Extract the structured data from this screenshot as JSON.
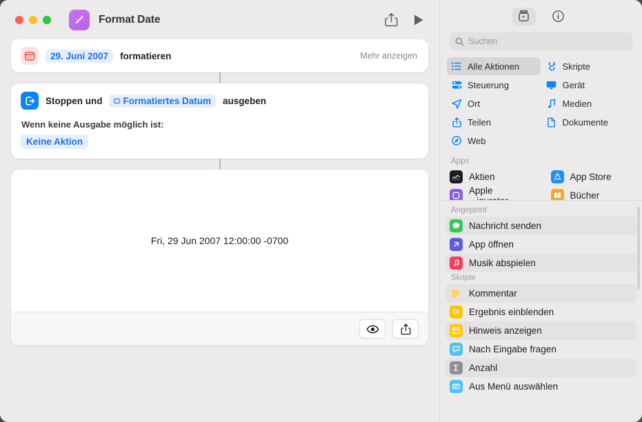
{
  "window": {
    "title": "Format Date",
    "app_icon": "magic-wand-icon",
    "traffic_lights": [
      "close",
      "minimize",
      "zoom"
    ],
    "toolbar": {
      "share_label": "share-icon",
      "run_label": "play-icon"
    }
  },
  "editor": {
    "actions": [
      {
        "id": "format-date",
        "icon": "calendar-icon",
        "token": "29. Juni 2007",
        "suffix": "formatieren",
        "more_label": "Mehr anzeigen"
      },
      {
        "id": "stop-and-output",
        "icon": "stop-output-icon",
        "prefix": "Stoppen und",
        "token": "Formatiertes Datum",
        "suffix": "ausgeben",
        "sub_label": "Wenn keine Ausgabe möglich ist:",
        "sub_token": "Keine Aktion"
      }
    ],
    "result": {
      "text": "Fri, 29 Jun 2007 12:00:00 -0700",
      "quicklook_label": "eye-icon",
      "share_label": "share-icon"
    }
  },
  "sidebar": {
    "segments": [
      {
        "name": "action-library",
        "icon": "library-icon",
        "selected": true
      },
      {
        "name": "info",
        "icon": "info-circle-icon",
        "selected": false
      }
    ],
    "search": {
      "placeholder": "Suchen",
      "value": "",
      "icon": "search-icon"
    },
    "categories": [
      {
        "label": "Alle Aktionen",
        "icon": "list-icon",
        "color": "#0A84FF",
        "selected": true
      },
      {
        "label": "Skripte",
        "icon": "script-icon",
        "color": "#0A84FF",
        "selected": false
      },
      {
        "label": "Steuerung",
        "icon": "controls-icon",
        "color": "#0A84FF",
        "selected": false
      },
      {
        "label": "Gerät",
        "icon": "display-icon",
        "color": "#0A84FF",
        "selected": false
      },
      {
        "label": "Ort",
        "icon": "location-icon",
        "color": "#0A84FF",
        "selected": false
      },
      {
        "label": "Medien",
        "icon": "music-note-icon",
        "color": "#0A84FF",
        "selected": false
      },
      {
        "label": "Teilen",
        "icon": "share-icon",
        "color": "#0A84FF",
        "selected": false
      },
      {
        "label": "Dokumente",
        "icon": "document-icon",
        "color": "#0A84FF",
        "selected": false
      },
      {
        "label": "Web",
        "icon": "safari-icon",
        "color": "#0A84FF",
        "selected": false
      }
    ],
    "sections": [
      {
        "title": "Apps",
        "layout": "grid",
        "items": [
          {
            "label": "Aktien",
            "icon": "stocks-app-icon",
            "color": "#1C1C1E"
          },
          {
            "label": "App Store",
            "icon": "app-store-icon",
            "color": "#1D8FF8"
          },
          {
            "label": "Apple ...igurator",
            "icon": "apple-configurator-icon",
            "color": "#8E5CE0"
          },
          {
            "label": "Bücher",
            "icon": "books-app-icon",
            "color": "#F5A623"
          }
        ]
      },
      {
        "title": "Angepinnt",
        "layout": "list",
        "items": [
          {
            "label": "Nachricht senden",
            "icon": "messages-icon",
            "color": "#34C759"
          },
          {
            "label": "App öffnen",
            "icon": "open-app-icon",
            "color": "#5E5CE6"
          },
          {
            "label": "Musik abspielen",
            "icon": "music-app-icon",
            "color": "#FC3C5C"
          }
        ]
      },
      {
        "title": "Skripte",
        "layout": "list",
        "items": [
          {
            "label": "Kommentar",
            "icon": "comment-icon",
            "color": "#FFC60B"
          },
          {
            "label": "Ergebnis einblenden",
            "icon": "show-result-icon",
            "color": "#FFC60B"
          },
          {
            "label": "Hinweis anzeigen",
            "icon": "alert-icon",
            "color": "#FFC60B"
          },
          {
            "label": "Nach Eingabe fragen",
            "icon": "ask-input-icon",
            "color": "#4CC2FA"
          },
          {
            "label": "Anzahl",
            "icon": "count-sigma-icon",
            "color": "#8E8E93"
          },
          {
            "label": "Aus Menü auswählen",
            "icon": "choose-menu-icon",
            "color": "#4CC2FA"
          }
        ]
      }
    ]
  },
  "colors": {
    "accent": "#0A84FF",
    "token_bg": "#E4EEFC",
    "token_text": "#1A73E8",
    "window_bg": "#ECEAEA",
    "card_bg": "#FFFFFF"
  }
}
